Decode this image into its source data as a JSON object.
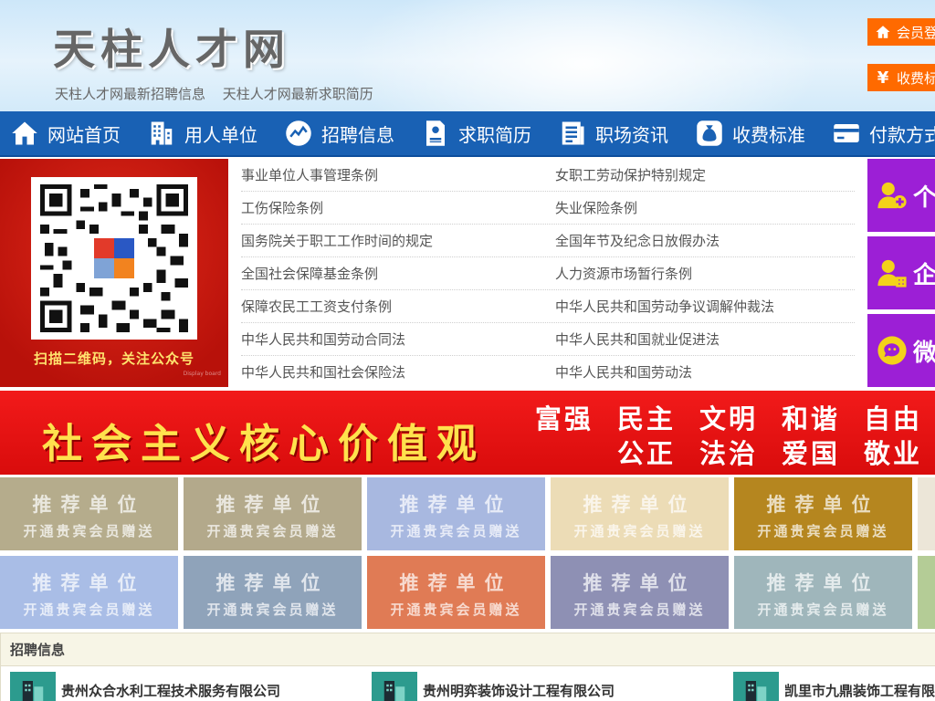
{
  "header": {
    "site_title": "天柱人才网",
    "links": [
      "天柱人才网最新招聘信息",
      "天柱人才网最新求职简历"
    ],
    "login_label": "会员登",
    "fee_label": "收费标",
    "fee_symbol": "¥"
  },
  "nav": {
    "items": [
      {
        "label": "网站首页",
        "icon": "home-icon"
      },
      {
        "label": "用人单位",
        "icon": "building-icon"
      },
      {
        "label": "招聘信息",
        "icon": "chart-icon"
      },
      {
        "label": "求职简历",
        "icon": "resume-icon"
      },
      {
        "label": "职场资讯",
        "icon": "news-icon"
      },
      {
        "label": "收费标准",
        "icon": "money-bag-icon"
      },
      {
        "label": "付款方式",
        "icon": "card-icon"
      }
    ]
  },
  "qr": {
    "caption": "扫描二维码，关注公众号",
    "tiny_text": "Display board"
  },
  "laws": [
    [
      "事业单位人事管理条例",
      "女职工劳动保护特别规定"
    ],
    [
      "工伤保险条例",
      "失业保险条例"
    ],
    [
      "国务院关于职工工作时间的规定",
      "全国年节及纪念日放假办法"
    ],
    [
      "全国社会保障基金条例",
      "人力资源市场暂行条例"
    ],
    [
      "保障农民工工资支付条例",
      "中华人民共和国劳动争议调解仲裁法"
    ],
    [
      "中华人民共和国劳动合同法",
      "中华人民共和国就业促进法"
    ],
    [
      "中华人民共和国社会保险法",
      "中华人民共和国劳动法"
    ]
  ],
  "side_buttons": [
    {
      "label": "个",
      "icon": "add-user-icon"
    },
    {
      "label": "企",
      "icon": "company-user-icon"
    },
    {
      "label": "微",
      "icon": "wechat-icon"
    }
  ],
  "banner": {
    "main": "社会主义核心价值观",
    "line1": [
      "富强",
      "民主",
      "文明",
      "和谐",
      "自由"
    ],
    "line2": [
      "公正",
      "法治",
      "爱国",
      "敬业"
    ]
  },
  "recommend": {
    "title": "推荐单位",
    "subtitle": "开通贵宾会员赠送",
    "colors_row1": [
      "#b5ac8c",
      "#b3a98b",
      "#a8b8e0",
      "#ecdcb6",
      "#b5861f",
      "#ece6d8"
    ],
    "colors_row2": [
      "#a9bde6",
      "#8fa3ba",
      "#e07b55",
      "#8e90b4",
      "#9fb6bb",
      "#b4cc96"
    ]
  },
  "recruit": {
    "heading": "招聘信息",
    "companies": [
      "贵州众合水利工程技术服务有限公司",
      "贵州明弈装饰设计工程有限公司",
      "凯里市九鼎装饰工程有限公司"
    ]
  }
}
